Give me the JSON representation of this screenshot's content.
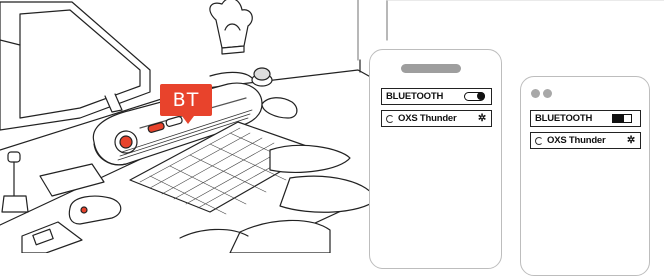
{
  "badge": {
    "text": "BT",
    "color": "#e8432c"
  },
  "phone_left": {
    "bluetooth_label": "BLUETOOTH",
    "device_name": "OXS Thunder"
  },
  "phone_right": {
    "bluetooth_label": "BLUETOOTH",
    "device_name": "OXS Thunder"
  },
  "icons": {
    "settings": "gear-icon",
    "connection": "spinner-ring-icon"
  }
}
